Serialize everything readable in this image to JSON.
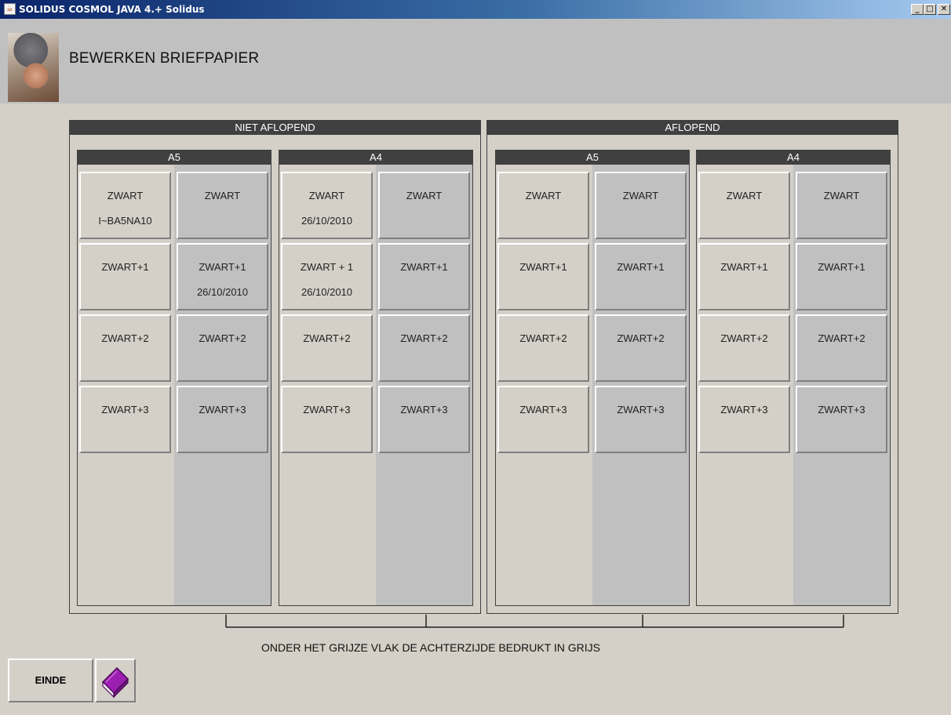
{
  "window": {
    "title": "SOLIDUS COSMOL JAVA 4.+ Solidus",
    "app_icon": "java-cup-icon",
    "controls": {
      "minimize": "_",
      "maximize": "□",
      "close": "✕"
    }
  },
  "header": {
    "title": "BEWERKEN BRIEFPAPIER",
    "avatar": "woman-portrait-avatar"
  },
  "groups": [
    {
      "label": "NIET AFLOPEND",
      "subgroups": [
        {
          "label": "A5",
          "rows": [
            [
              {
                "label": "ZWART",
                "sub": "I~BA5NA10"
              },
              {
                "label": "ZWART",
                "sub": ""
              }
            ],
            [
              {
                "label": "ZWART+1",
                "sub": ""
              },
              {
                "label": "ZWART+1",
                "sub": "26/10/2010"
              }
            ],
            [
              {
                "label": "ZWART+2",
                "sub": ""
              },
              {
                "label": "ZWART+2",
                "sub": ""
              }
            ],
            [
              {
                "label": "ZWART+3",
                "sub": ""
              },
              {
                "label": "ZWART+3",
                "sub": ""
              }
            ]
          ]
        },
        {
          "label": "A4",
          "rows": [
            [
              {
                "label": "ZWART",
                "sub": "26/10/2010"
              },
              {
                "label": "ZWART",
                "sub": ""
              }
            ],
            [
              {
                "label": "ZWART + 1",
                "sub": "26/10/2010"
              },
              {
                "label": "ZWART+1",
                "sub": ""
              }
            ],
            [
              {
                "label": "ZWART+2",
                "sub": ""
              },
              {
                "label": "ZWART+2",
                "sub": ""
              }
            ],
            [
              {
                "label": "ZWART+3",
                "sub": ""
              },
              {
                "label": "ZWART+3",
                "sub": ""
              }
            ]
          ]
        }
      ]
    },
    {
      "label": "AFLOPEND",
      "subgroups": [
        {
          "label": "A5",
          "rows": [
            [
              {
                "label": "ZWART",
                "sub": ""
              },
              {
                "label": "ZWART",
                "sub": ""
              }
            ],
            [
              {
                "label": "ZWART+1",
                "sub": ""
              },
              {
                "label": "ZWART+1",
                "sub": ""
              }
            ],
            [
              {
                "label": "ZWART+2",
                "sub": ""
              },
              {
                "label": "ZWART+2",
                "sub": ""
              }
            ],
            [
              {
                "label": "ZWART+3",
                "sub": ""
              },
              {
                "label": "ZWART+3",
                "sub": ""
              }
            ]
          ]
        },
        {
          "label": "A4",
          "rows": [
            [
              {
                "label": "ZWART",
                "sub": ""
              },
              {
                "label": "ZWART",
                "sub": ""
              }
            ],
            [
              {
                "label": "ZWART+1",
                "sub": ""
              },
              {
                "label": "ZWART+1",
                "sub": ""
              }
            ],
            [
              {
                "label": "ZWART+2",
                "sub": ""
              },
              {
                "label": "ZWART+2",
                "sub": ""
              }
            ],
            [
              {
                "label": "ZWART+3",
                "sub": ""
              },
              {
                "label": "ZWART+3",
                "sub": ""
              }
            ]
          ]
        }
      ]
    }
  ],
  "note": "ONDER HET GRIJZE VLAK DE ACHTERZIJDE BEDRUKT IN GRIJS",
  "footer": {
    "einde_label": "EINDE",
    "book_icon": "purple-book-icon"
  },
  "colors": {
    "header_bar": "#404040",
    "back_side_gray": "#c0c0c0",
    "front_side": "#d4d0c8",
    "book": "#9b1fb0"
  }
}
